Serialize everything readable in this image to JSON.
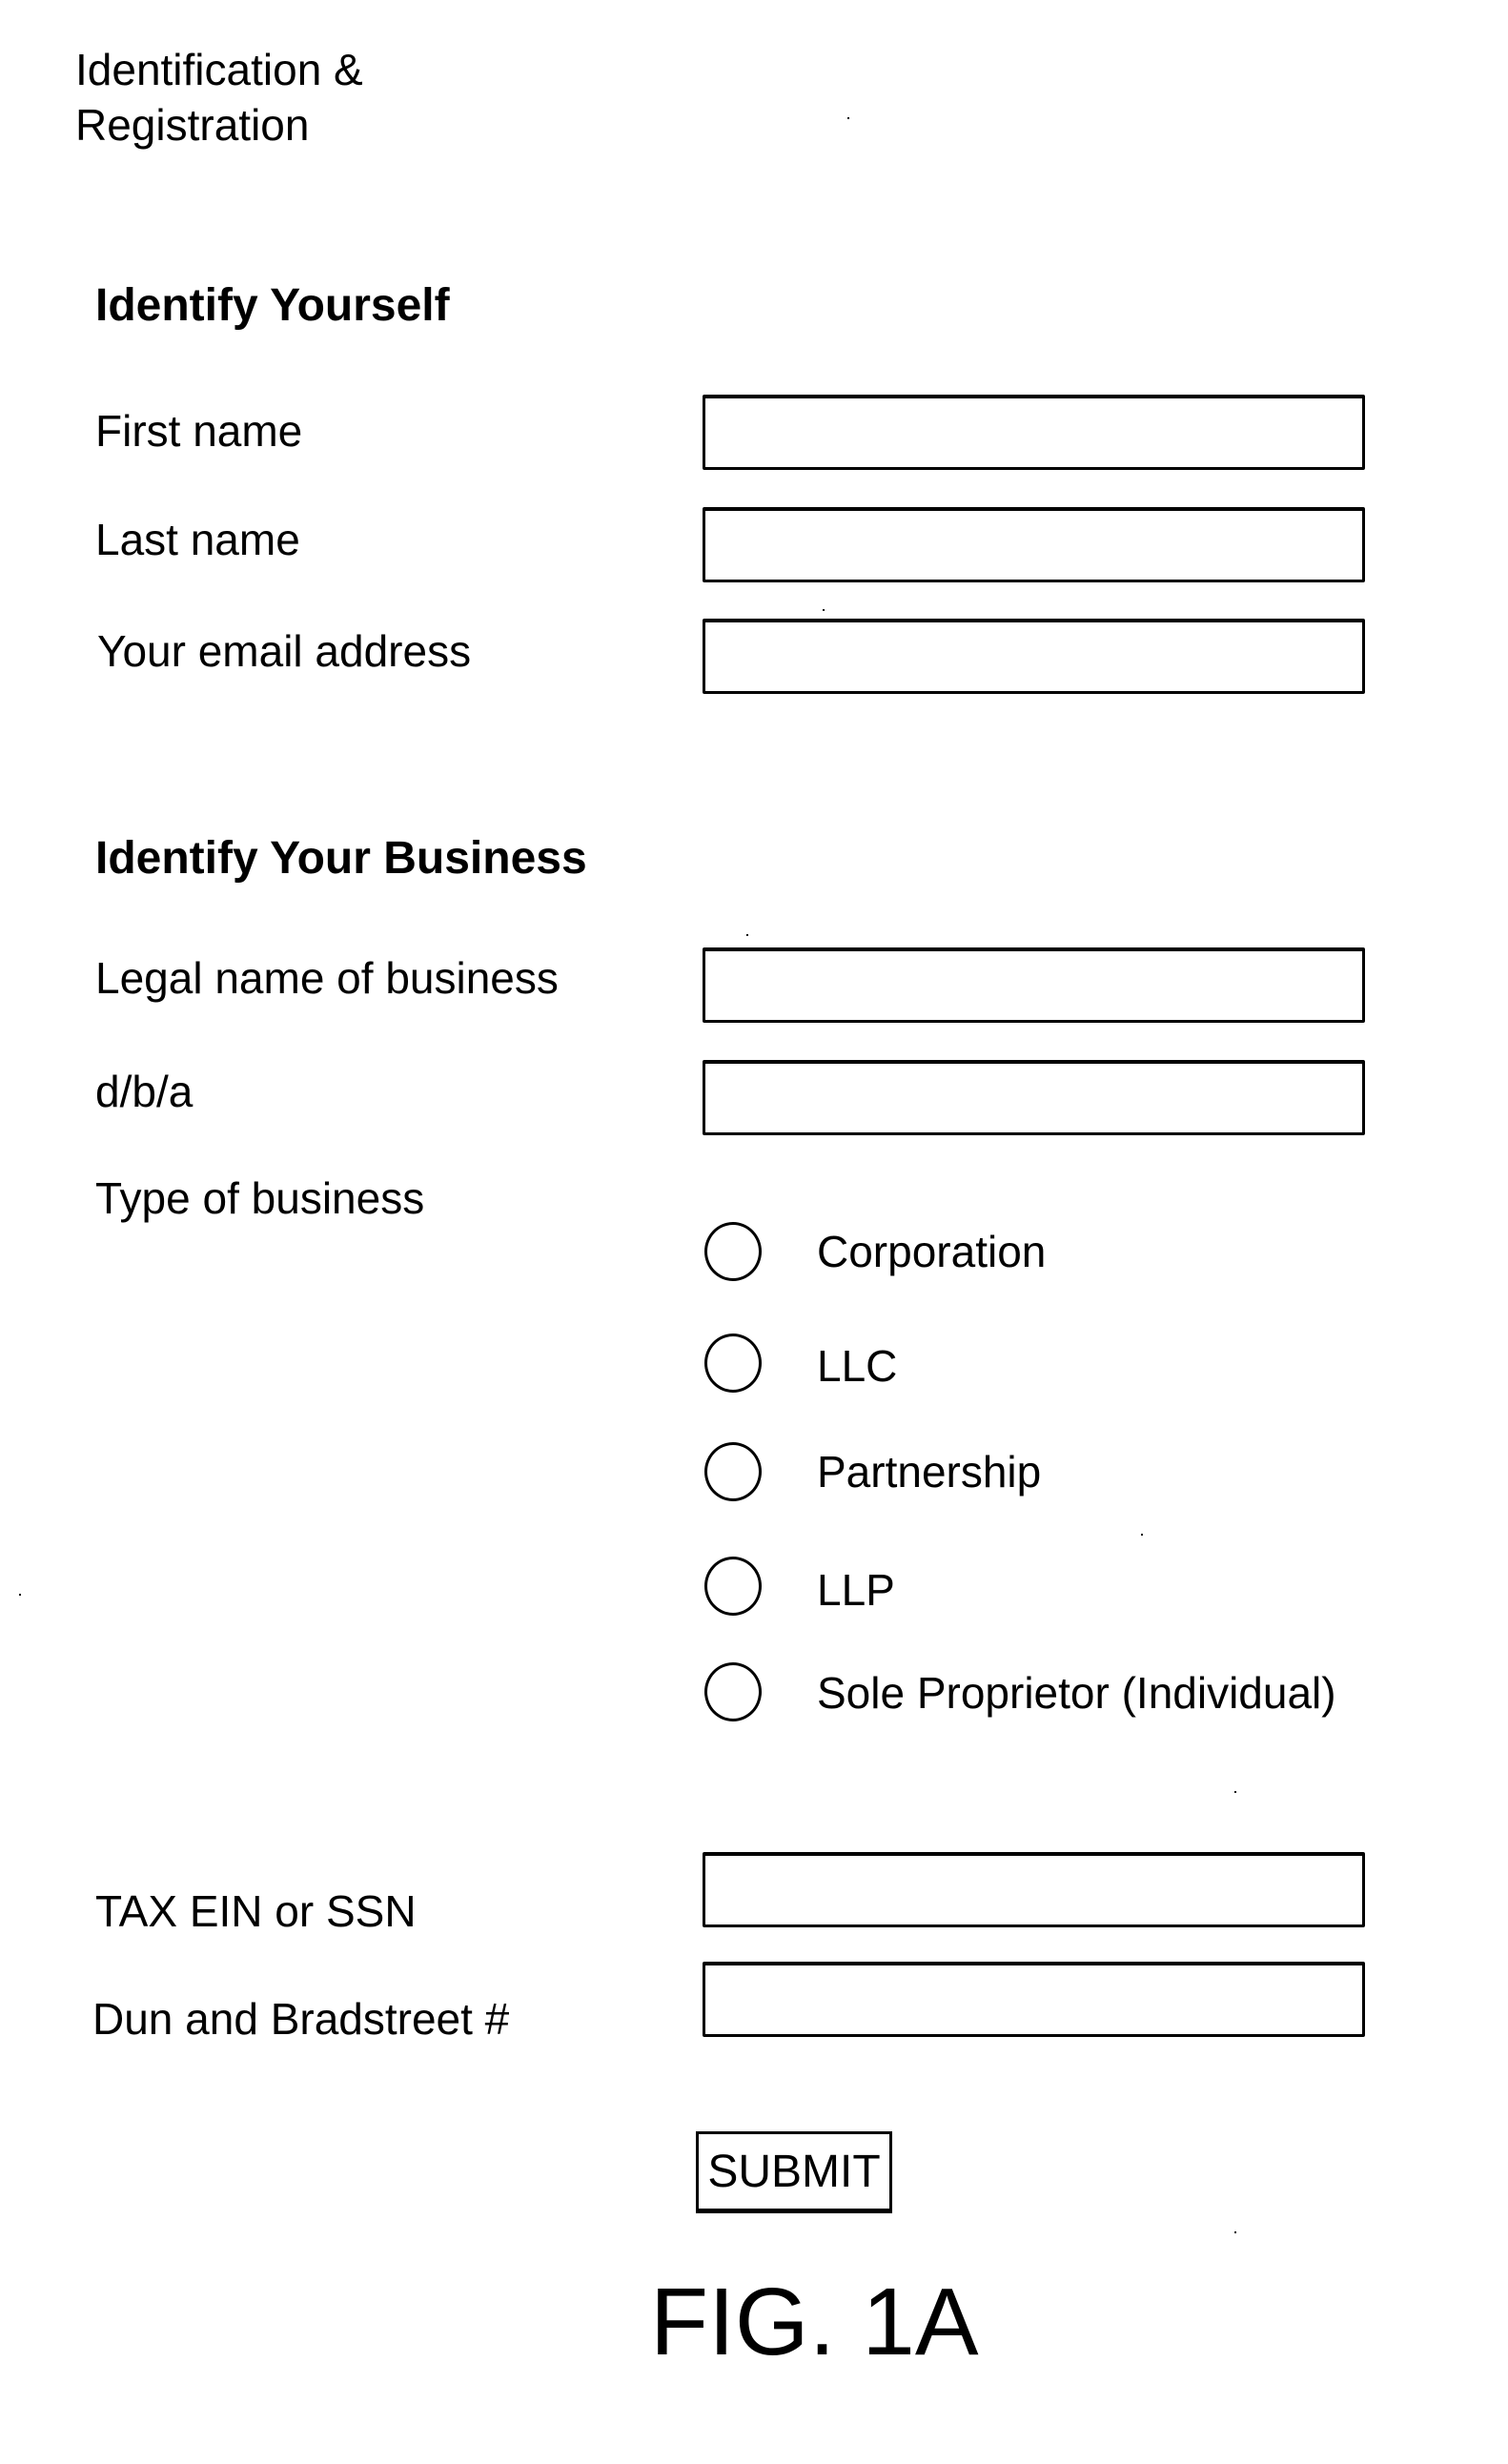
{
  "page": {
    "title": "Identification & Registration",
    "title_line1": "Identification &",
    "title_line2": "Registration",
    "figure_label": "FIG. 1A"
  },
  "identify_yourself": {
    "heading": "Identify Yourself",
    "fields": [
      {
        "label": "First name",
        "value": "",
        "placeholder": ""
      },
      {
        "label": "Last name",
        "value": "",
        "placeholder": ""
      },
      {
        "label": "Your email address",
        "value": "",
        "placeholder": ""
      }
    ]
  },
  "identify_business": {
    "heading": "Identify Your Business",
    "fields": [
      {
        "label": "Legal name of business",
        "value": "",
        "placeholder": ""
      },
      {
        "label": "d/b/a",
        "value": "",
        "placeholder": ""
      }
    ],
    "business_type": {
      "label": "Type of business",
      "selected": null,
      "options": [
        {
          "label": "Corporation",
          "checked": false
        },
        {
          "label": "LLC",
          "checked": false
        },
        {
          "label": "Partnership",
          "checked": false
        },
        {
          "label": "LLP",
          "checked": false
        },
        {
          "label": "Sole Proprietor (Individual)",
          "checked": false
        }
      ]
    },
    "id_fields": [
      {
        "label": "TAX EIN or SSN",
        "value": "",
        "placeholder": ""
      },
      {
        "label": "Dun and Bradstreet #",
        "value": "",
        "placeholder": ""
      }
    ]
  },
  "actions": {
    "submit_label": "SUBMIT"
  }
}
